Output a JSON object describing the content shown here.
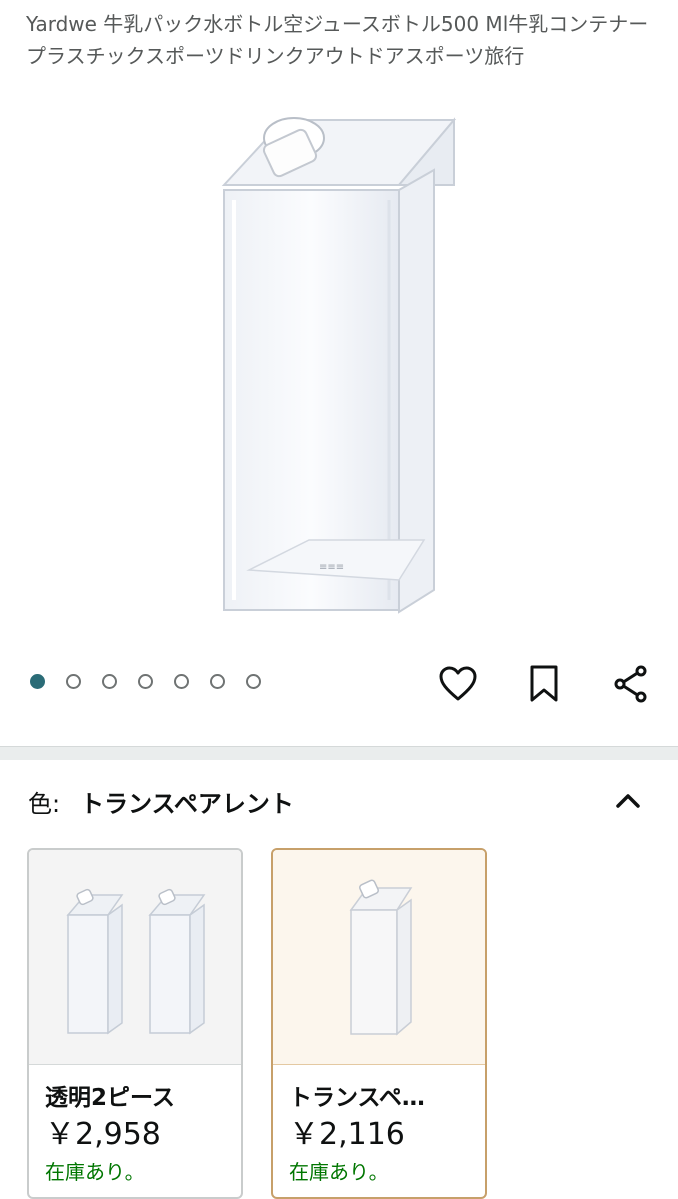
{
  "product": {
    "title": "Yardwe 牛乳パック水ボトル空ジュースボトル500 Ml牛乳コンテナープラスチックスポーツドリンクアウトドアスポーツ旅行"
  },
  "gallery": {
    "image_count": 7,
    "active_index": 0
  },
  "actions": {
    "favorite_icon": "heart-icon",
    "save_icon": "bookmark-icon",
    "share_icon": "share-icon"
  },
  "variation": {
    "label": "色:",
    "selected": "トランスペアレント",
    "collapse_icon": "chevron-up-icon"
  },
  "options": [
    {
      "name": "透明2ピース",
      "price": "￥2,958",
      "stock": "在庫あり。"
    },
    {
      "name": "トランスペ…",
      "price": "￥2,116",
      "stock": "在庫あり。"
    }
  ],
  "colors": {
    "accent_dot": "#2b6c77",
    "selected_border": "#c7a06a",
    "in_stock": "#007600"
  }
}
